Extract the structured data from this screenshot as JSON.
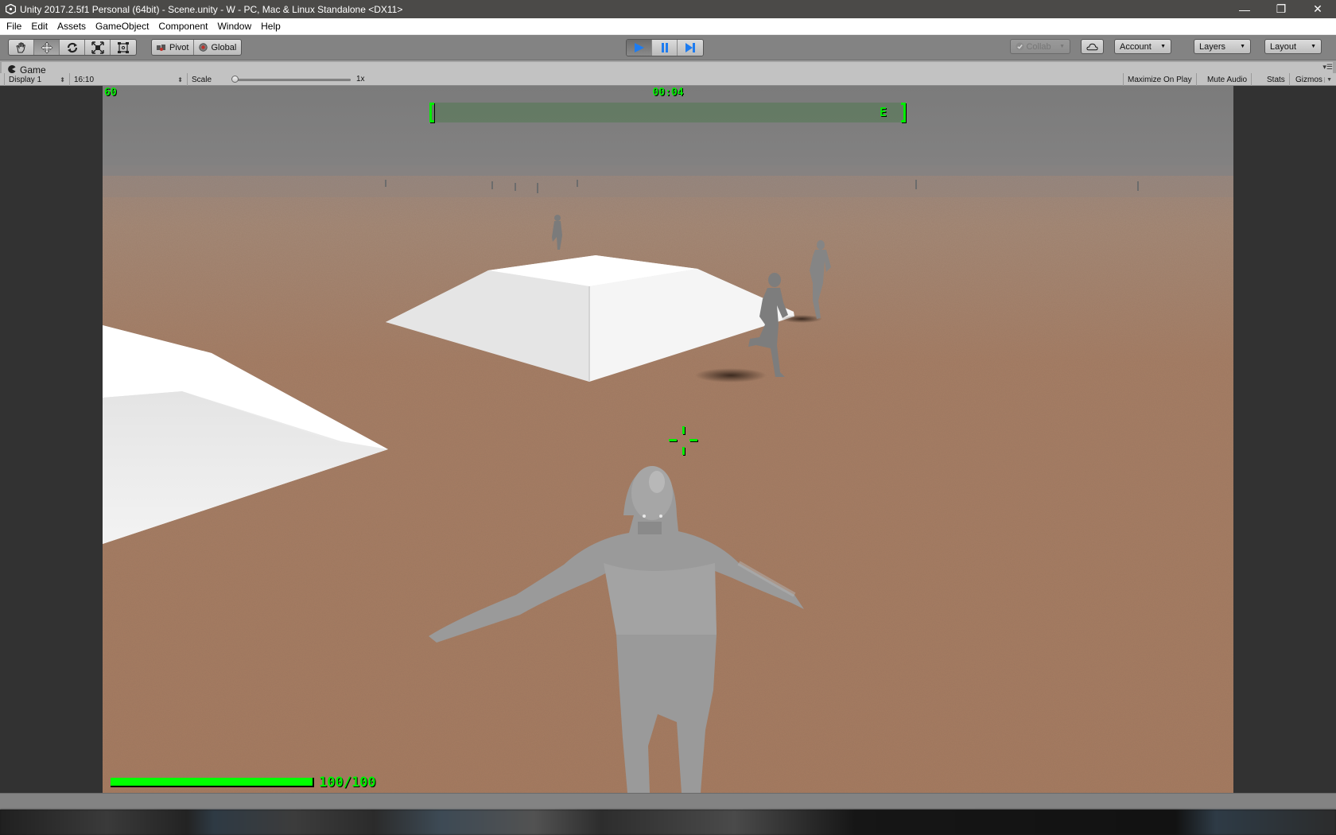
{
  "window": {
    "title": "Unity 2017.2.5f1 Personal (64bit) - Scene.unity - W - PC, Mac & Linux Standalone <DX11>",
    "controls": {
      "minimize": "—",
      "restore": "❐",
      "close": "✕"
    }
  },
  "menu": [
    "File",
    "Edit",
    "Assets",
    "GameObject",
    "Component",
    "Window",
    "Help"
  ],
  "toolbar": {
    "transform_tools": [
      {
        "name": "hand-tool",
        "icon": "hand-icon",
        "glyph": "✋",
        "active": false
      },
      {
        "name": "move-tool",
        "icon": "move-icon",
        "glyph": "✥",
        "active": true
      },
      {
        "name": "rotate-tool",
        "icon": "rotate-icon",
        "glyph": "⟳",
        "active": false
      },
      {
        "name": "scale-tool",
        "icon": "scale-icon",
        "glyph": "⤧",
        "active": false
      },
      {
        "name": "rect-tool",
        "icon": "rect-transform-icon",
        "glyph": "⊡",
        "active": false
      }
    ],
    "pivot_label": "Pivot",
    "global_label": "Global",
    "playback": {
      "play_active": true,
      "pause_active": false
    },
    "collab_label": "Collab",
    "account_label": "Account",
    "layers_label": "Layers",
    "layout_label": "Layout"
  },
  "game_panel": {
    "tab_label": "Game",
    "display_label": "Display 1",
    "aspect_label": "16:10",
    "scale_label": "Scale",
    "scale_value_label": "1x",
    "scale_value": 1,
    "maximize_label": "Maximize On Play",
    "mute_label": "Mute Audio",
    "stats_label": "Stats",
    "gizmos_label": "Gizmos"
  },
  "hud": {
    "fps": "60",
    "timer": "00:04",
    "compass_heading": "E",
    "health_text": "100/100",
    "health_current": 100,
    "health_max": 100,
    "hud_color": "#00ee00",
    "health_color": "#00ff00"
  },
  "scene": {
    "sky_color": "#808080",
    "ground_color": "#a97a5f",
    "horizon_color": "#a08878",
    "ramp_color": "#f1f1f1",
    "character_color": "#8e8e8e"
  }
}
